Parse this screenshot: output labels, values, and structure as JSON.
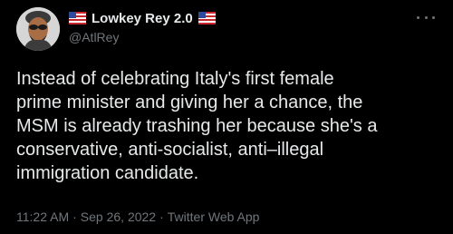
{
  "author": {
    "display_name": "Lowkey Rey 2.0",
    "handle": "@AtlRey",
    "avatar_icon": "cartoon-avatar",
    "name_badges": [
      "us-flag-icon",
      "us-flag-icon"
    ]
  },
  "tweet": {
    "text": "Instead of celebrating Italy's first female\nprime minister and giving her a chance, the\nMSM is already trashing her because she's a\nconservative, anti-socialist, anti–illegal\nimmigration candidate.",
    "time": "11:22 AM",
    "date": "Sep 26, 2022",
    "source": "Twitter Web App",
    "separator": "·"
  },
  "more_menu_icon": "ellipsis-icon",
  "colors": {
    "background": "#000000",
    "primary_text": "#e7e9ea",
    "secondary_text": "#71767b"
  }
}
